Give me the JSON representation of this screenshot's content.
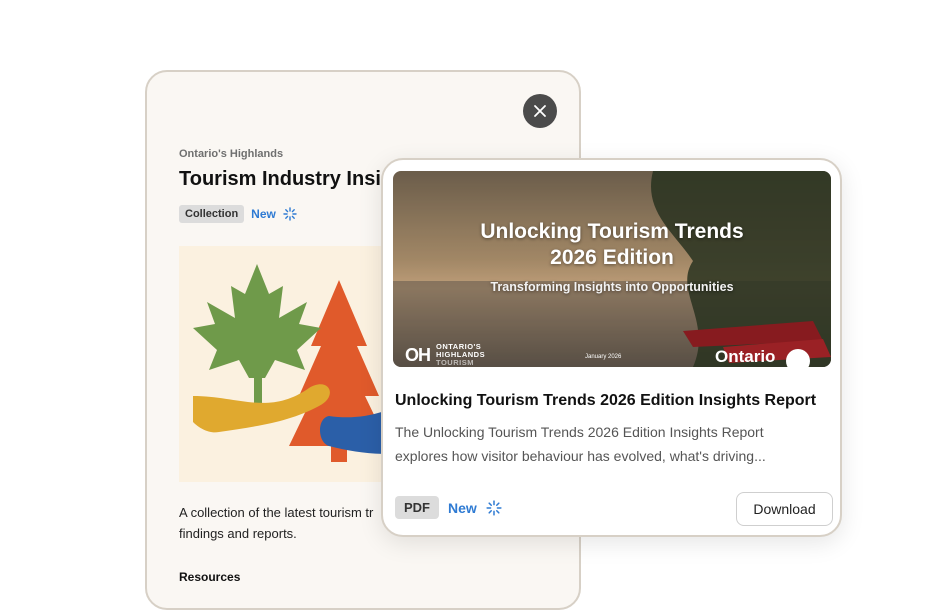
{
  "back_card": {
    "organization": "Ontario's Highlands",
    "title": "Tourism Industry Insigh",
    "tag": "Collection",
    "new_label": "New",
    "description": "A collection of the latest tourism tr findings and reports.",
    "resources_heading": "Resources"
  },
  "front_card": {
    "hero": {
      "title_line1": "Unlocking Tourism Trends",
      "title_line2": "2026 Edition",
      "subtitle": "Transforming Insights into Opportunities",
      "logo_mark": "OH",
      "logo_line1": "ONTARIO'S",
      "logo_line2": "HIGHLANDS",
      "logo_line3": "TOURISM",
      "date": "January 2026",
      "brand": "Ontario"
    },
    "title": "Unlocking Tourism Trends 2026 Edition Insights Report",
    "description": "The Unlocking Tourism Trends 2026 Edition Insights Report explores how visitor behaviour has evolved, what's driving...",
    "file_type": "PDF",
    "new_label": "New",
    "download_label": "Download"
  },
  "colors": {
    "accent_blue": "#2f7bd3",
    "card_border": "#d7d0c6",
    "close_button": "#4b4b4b"
  }
}
